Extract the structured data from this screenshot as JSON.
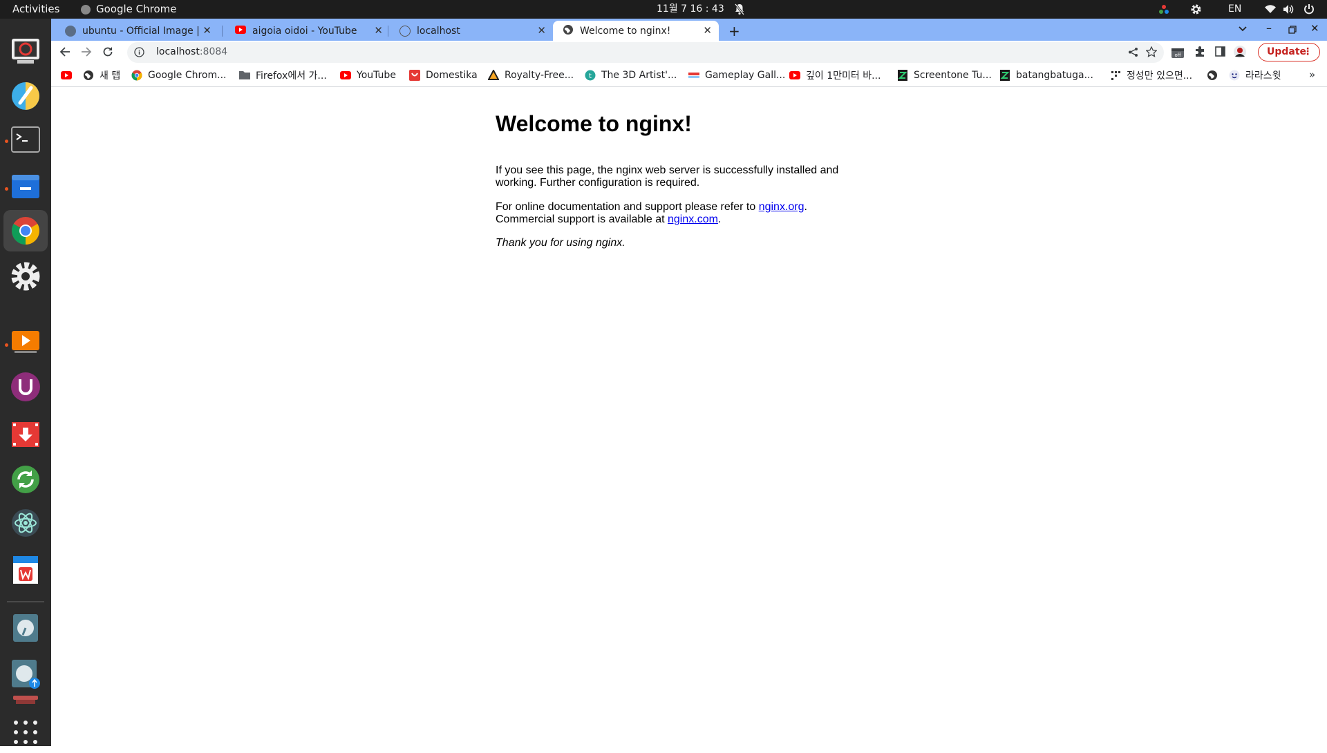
{
  "topbar": {
    "activities": "Activities",
    "app_name": "Google Chrome",
    "clock": "11월 7  16 : 43",
    "lang": "EN"
  },
  "tabs": [
    {
      "title": "ubuntu - Official Image | D",
      "active": false
    },
    {
      "title": "aigoia oidoi - YouTube",
      "active": false
    },
    {
      "title": "localhost",
      "active": false
    },
    {
      "title": "Welcome to nginx!",
      "active": true
    }
  ],
  "toolbar": {
    "url_host": "localhost",
    "url_port": ":8084",
    "update_label": "Update"
  },
  "bookmarks": [
    {
      "label": "",
      "icon": "youtube-icon"
    },
    {
      "label": "새 탭",
      "icon": "globe-icon"
    },
    {
      "label": "Google Chrom...",
      "icon": "chrome-icon"
    },
    {
      "label": "Firefox에서 가...",
      "icon": "folder-icon"
    },
    {
      "label": "YouTube",
      "icon": "youtube-icon"
    },
    {
      "label": "Domestika",
      "icon": "domestika-icon"
    },
    {
      "label": "Royalty-Free...",
      "icon": "triangle-icon"
    },
    {
      "label": "The 3D Artist'...",
      "icon": "t-circle-icon"
    },
    {
      "label": "Gameplay Gall...",
      "icon": "flag-icon"
    },
    {
      "label": "깊이 1만미터 바...",
      "icon": "youtube-icon"
    },
    {
      "label": "Screentone Tu...",
      "icon": "z-icon"
    },
    {
      "label": "batangbatuga...",
      "icon": "z-icon"
    },
    {
      "label": "정성만 있으면...",
      "icon": "dots-icon"
    },
    {
      "label": "",
      "icon": "globe-icon"
    },
    {
      "label": "라라스윗",
      "icon": "smile-icon"
    }
  ],
  "page": {
    "heading": "Welcome to nginx!",
    "p1": "If you see this page, the nginx web server is successfully installed and working. Further configuration is required.",
    "p2_prefix": "For online documentation and support please refer to ",
    "p2_link": "nginx.org",
    "p2_mid": ".",
    "p2_line2": "Commercial support is available at ",
    "p2_link2": "nginx.com",
    "p2_end": ".",
    "p3": "Thank you for using nginx."
  },
  "colors": {
    "tabstrip": "#8ab4f8",
    "link": "#0000ee",
    "update_red": "#c5221f",
    "ubuntu_orange": "#e95420"
  }
}
